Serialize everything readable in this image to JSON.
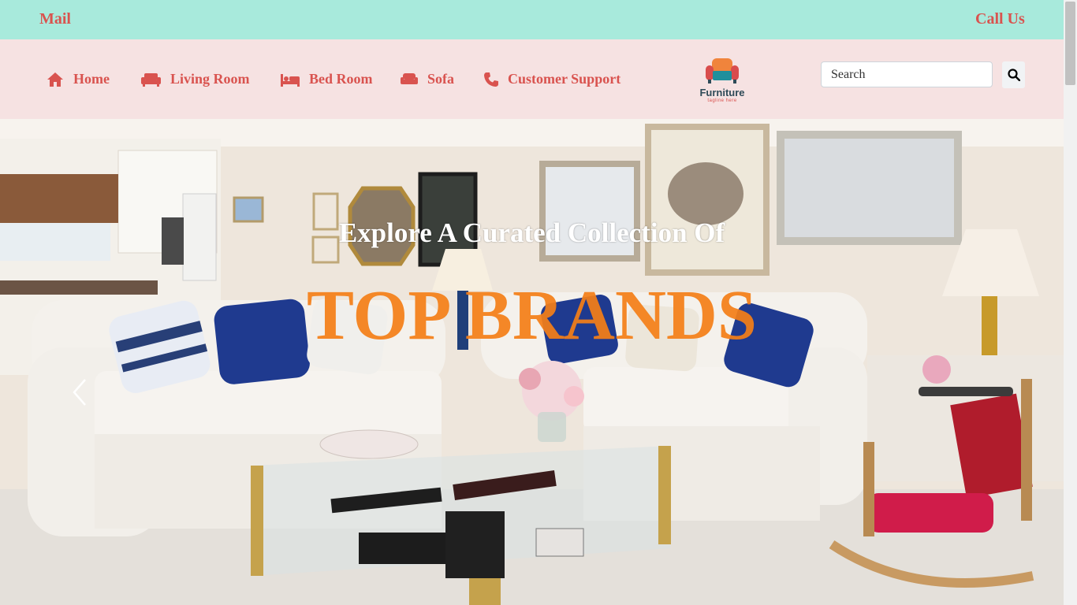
{
  "topbar": {
    "mail_label": "Mail",
    "call_label": "Call Us"
  },
  "nav": {
    "items": [
      {
        "label": "Home",
        "icon": "home-icon"
      },
      {
        "label": "Living Room",
        "icon": "couch-icon"
      },
      {
        "label": "Bed Room",
        "icon": "bed-icon"
      },
      {
        "label": "Sofa",
        "icon": "sofa-icon"
      },
      {
        "label": "Customer Support",
        "icon": "phone-icon"
      }
    ]
  },
  "logo": {
    "name": "Furniture",
    "tagline": "tagline here"
  },
  "search": {
    "placeholder": "Search",
    "button_icon": "search-icon"
  },
  "hero": {
    "heading": "Explore A Curated Collection Of",
    "brand_text": "TOP BRANDS",
    "prev_icon": "chevron-left-icon"
  },
  "colors": {
    "topbar_bg": "#a8eadc",
    "navbar_bg": "#f6e2e2",
    "accent_red": "#d9534f",
    "brand_orange": "#f57f17"
  }
}
